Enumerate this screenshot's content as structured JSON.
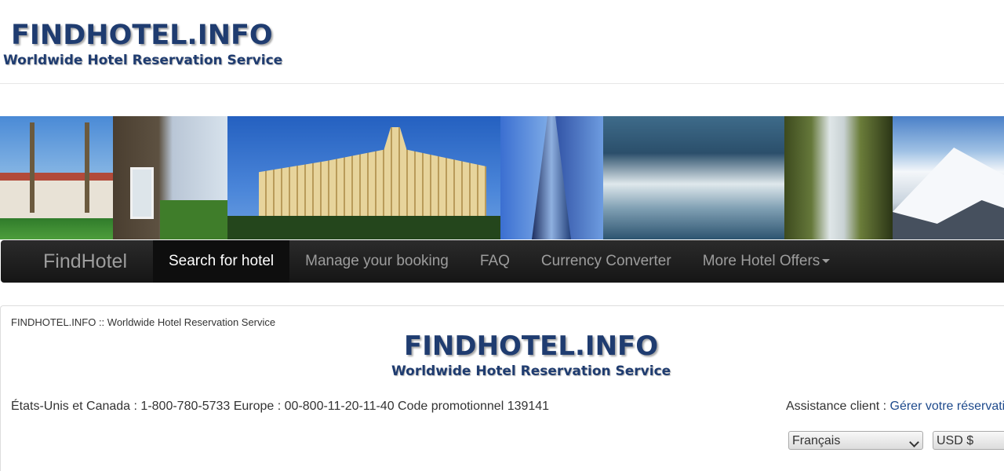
{
  "header": {
    "logo_title": "FINDHOTEL.INFO",
    "logo_subtitle": "Worldwide Hotel Reservation Service"
  },
  "navbar": {
    "brand": "FindHotel",
    "items": [
      {
        "label": "Search for hotel",
        "active": true
      },
      {
        "label": "Manage your booking"
      },
      {
        "label": "FAQ"
      },
      {
        "label": "Currency Converter"
      },
      {
        "label": "More Hotel Offers"
      }
    ]
  },
  "content": {
    "breadcrumb": "FINDHOTEL.INFO :: Worldwide Hotel Reservation Service",
    "logo_title": "FINDHOTEL.INFO",
    "logo_subtitle": "Worldwide Hotel Reservation Service",
    "contact": "États-Unis et Canada : 1-800-780-5733 Europe : 00-800-11-20-11-40 Code promotionnel 139141",
    "assistance_label": "Assistance client : ",
    "assistance_link": "Gérer votre réservation",
    "language_select": "Français",
    "currency_select": "USD $"
  },
  "colors": {
    "logo": "#1f3c70",
    "navbar": "#222222",
    "link": "#1e4a8c"
  }
}
